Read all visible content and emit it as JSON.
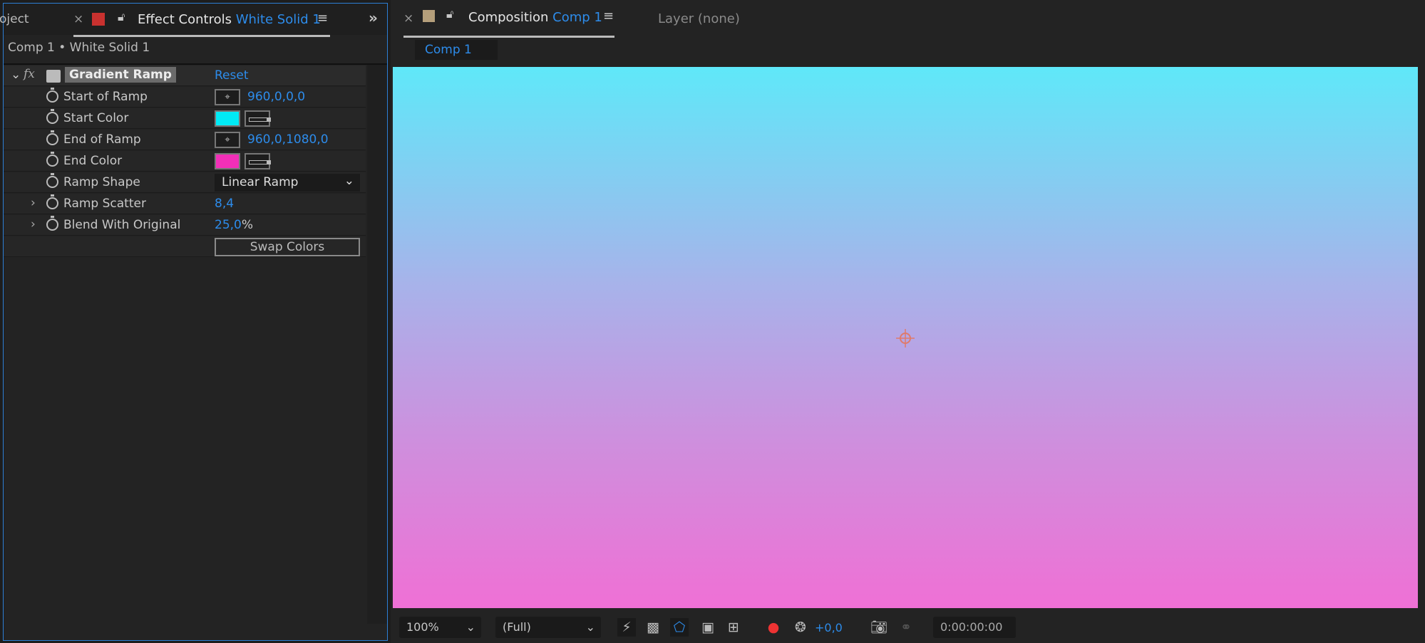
{
  "left_panel": {
    "project_tab": "oject",
    "tab_prefix": "Effect Controls",
    "tab_layer": "White Solid 1",
    "breadcrumb": "Comp 1 • White Solid 1",
    "effect": {
      "fx": "fx",
      "name": "Gradient Ramp",
      "reset": "Reset"
    },
    "properties": [
      {
        "label": "Start of Ramp",
        "value": "960,0,0,0",
        "type": "point"
      },
      {
        "label": "Start Color",
        "type": "color",
        "color": "#00eaf5"
      },
      {
        "label": "End of Ramp",
        "value": "960,0,1080,0",
        "type": "point"
      },
      {
        "label": "End Color",
        "type": "color",
        "color": "#f22fb8"
      },
      {
        "label": "Ramp Shape",
        "value": "Linear Ramp",
        "type": "dropdown"
      },
      {
        "label": "Ramp Scatter",
        "value": "8,4",
        "type": "number"
      },
      {
        "label": "Blend With Original",
        "value": "25,0",
        "unit": "%",
        "type": "number"
      }
    ],
    "swap_button": "Swap Colors",
    "label_color": "#c9312f"
  },
  "right_panel": {
    "tab_prefix": "Composition",
    "tab_comp": "Comp 1",
    "layer_tab": "Layer (none)",
    "comp_chip": "Comp 1",
    "label_color": "#b59f7b",
    "gradient": {
      "top": "#5fe8f9",
      "bottom": "#ef70d5"
    },
    "toolbar": {
      "zoom": "100%",
      "resolution": "(Full)",
      "exposure": "+0,0",
      "timecode": "0:00:00:00"
    }
  }
}
